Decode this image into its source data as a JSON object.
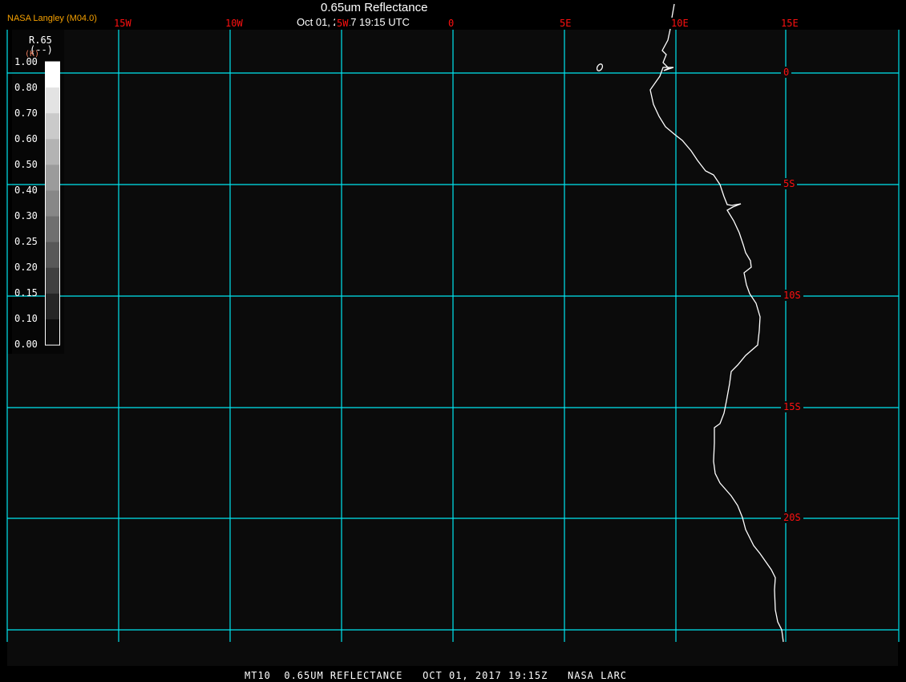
{
  "header": {
    "title": "0.65um Reflectance",
    "subtitle": "Oct 01, 2017 19:15 UTC",
    "brand": "NASA Langley (M04.0)"
  },
  "legend": {
    "variable": "R.65",
    "units": "(--)",
    "units_overlay": "(K)",
    "labels": [
      "1.00",
      "0.80",
      "0.70",
      "0.60",
      "0.50",
      "0.40",
      "0.30",
      "0.25",
      "0.20",
      "0.15",
      "0.10",
      "0.00"
    ],
    "colors": [
      "#ffffff",
      "#e3e3e3",
      "#cacaca",
      "#b3b3b3",
      "#9b9b9b",
      "#878787",
      "#6f6f6f",
      "#585858",
      "#404040",
      "#262626",
      "#0d0d0d"
    ]
  },
  "map": {
    "longitude_labels": [
      "15W",
      "10W",
      "5W",
      "0",
      "5E",
      "10E",
      "15E"
    ],
    "latitude_labels": [
      "0",
      "5S",
      "10S",
      "15S",
      "20S"
    ],
    "grid_color": "#00e5f0",
    "label_color": "#ff1010",
    "coastline_color": "#ffffff"
  },
  "footer": {
    "text": "MT10  0.65UM REFLECTANCE   OCT 01, 2017 19:15Z   NASA LARC"
  }
}
